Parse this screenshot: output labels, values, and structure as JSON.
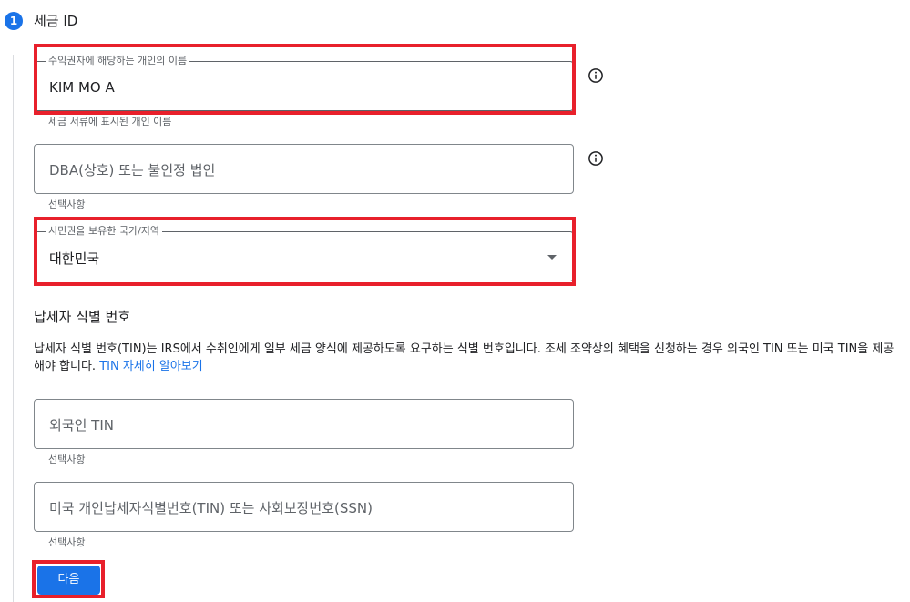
{
  "step": {
    "number": "1",
    "title": "세금 ID"
  },
  "payee_name": {
    "label": "수익권자에 해당하는 개인의 이름",
    "value": "KIM MO A",
    "helper": "세금 서류에 표시된 개인 이름"
  },
  "dba": {
    "placeholder": "DBA(상호) 또는 불인정 법인",
    "helper": "선택사항"
  },
  "country": {
    "label": "시민권을 보유한 국가/지역",
    "value": "대한민국"
  },
  "tin_section": {
    "heading": "납세자 식별 번호",
    "description": "납세자 식별 번호(TIN)는 IRS에서 수취인에게 일부 세금 양식에 제공하도록 요구하는 식별 번호입니다. 조세 조약상의 혜택을 신청하는 경우 외국인 TIN 또는 미국 TIN을 제공해야 합니다.",
    "link_text": "TIN 자세히 알아보기"
  },
  "foreign_tin": {
    "placeholder": "외국인 TIN",
    "helper": "선택사항"
  },
  "us_tin": {
    "placeholder": "미국 개인납세자식별번호(TIN) 또는 사회보장번호(SSN)",
    "helper": "선택사항"
  },
  "next_button": {
    "label": "다음"
  },
  "colors": {
    "accent": "#1a73e8",
    "highlight": "#e8202b"
  },
  "icons": {
    "info": "info-icon",
    "dropdown": "dropdown-arrow-icon"
  }
}
